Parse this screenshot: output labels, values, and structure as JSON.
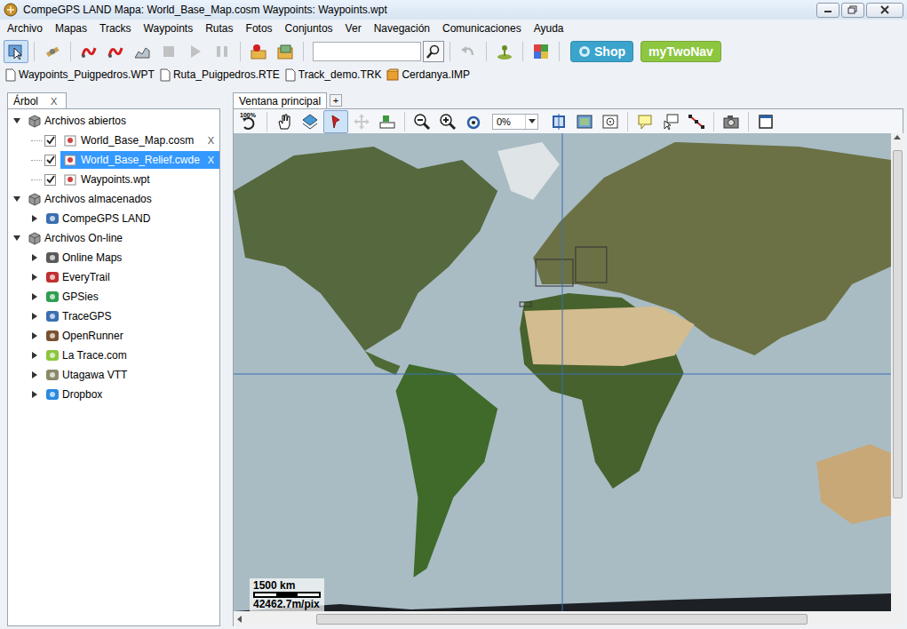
{
  "window": {
    "title": "CompeGPS LAND Mapa: World_Base_Map.cosm Waypoints:  Waypoints.wpt"
  },
  "menu": [
    "Archivo",
    "Mapas",
    "Tracks",
    "Waypoints",
    "Rutas",
    "Fotos",
    "Conjuntos",
    "Ver",
    "Navegación",
    "Comunicaciones",
    "Ayuda"
  ],
  "main_toolbar": {
    "buttons": [
      {
        "selected": true,
        "disabled": false
      },
      {
        "selected": false,
        "disabled": false
      },
      {
        "selected": false,
        "disabled": false
      },
      {
        "selected": false,
        "disabled": false
      },
      {
        "selected": false,
        "disabled": false
      },
      {
        "selected": false,
        "disabled": true
      },
      {
        "selected": false,
        "disabled": true
      },
      {
        "selected": false,
        "disabled": true
      },
      {
        "selected": false,
        "disabled": false
      },
      {
        "selected": false,
        "disabled": false
      },
      {
        "selected": false,
        "disabled": true
      },
      {
        "selected": false,
        "disabled": false
      },
      {
        "selected": false,
        "disabled": false
      }
    ],
    "search": {
      "value": ""
    },
    "shop": "Shop",
    "brand": "myTwoNav"
  },
  "open_files": [
    {
      "name": "Waypoints_Puigpedros.WPT",
      "kind": "document"
    },
    {
      "name": "Ruta_Puigpedros.RTE",
      "kind": "document"
    },
    {
      "name": "Track_demo.TRK",
      "kind": "document"
    },
    {
      "name": "Cerdanya.IMP",
      "kind": "package"
    }
  ],
  "tree_panel": {
    "tab": "Árbol",
    "close": "X"
  },
  "tree": [
    {
      "label": "Archivos abiertos",
      "expanded": true,
      "children": [
        {
          "kind": "layer",
          "label": "World_Base_Map.cosm",
          "checked": true,
          "selected": false,
          "close": "X"
        },
        {
          "kind": "layer",
          "label": "World_Base_Relief.cwde",
          "checked": true,
          "selected": true,
          "close": "X"
        },
        {
          "kind": "layer",
          "label": "Waypoints.wpt",
          "checked": true,
          "selected": false
        }
      ]
    },
    {
      "label": "Archivos almacenados",
      "expanded": true,
      "children": [
        {
          "kind": "source",
          "label": "CompeGPS LAND",
          "expanded": false
        }
      ]
    },
    {
      "label": "Archivos On-line",
      "expanded": true,
      "children": [
        {
          "kind": "source",
          "label": "Online Maps",
          "expanded": false
        },
        {
          "kind": "source",
          "label": "EveryTrail",
          "expanded": false
        },
        {
          "kind": "source",
          "label": "GPSies",
          "expanded": false
        },
        {
          "kind": "source",
          "label": "TraceGPS",
          "expanded": false
        },
        {
          "kind": "source",
          "label": "OpenRunner",
          "expanded": false
        },
        {
          "kind": "source",
          "label": "La Trace.com",
          "expanded": false
        },
        {
          "kind": "source",
          "label": "Utagawa VTT",
          "expanded": false
        },
        {
          "kind": "source",
          "label": "Dropbox",
          "expanded": false
        }
      ]
    }
  ],
  "map_panel": {
    "tab": "Ventana principal",
    "add": "+",
    "zoom_badge": "100%",
    "zoom": "0%",
    "buttons": [
      {
        "selected": false,
        "disabled": false
      },
      {
        "selected": false,
        "disabled": false
      },
      {
        "selected": false,
        "disabled": false
      },
      {
        "selected": true,
        "disabled": false
      },
      {
        "selected": false,
        "disabled": true
      },
      {
        "selected": false,
        "disabled": false
      },
      {
        "selected": false,
        "disabled": false
      },
      {
        "selected": false,
        "disabled": false
      },
      {
        "selected": false,
        "disabled": false
      },
      {
        "selected": false,
        "disabled": false
      },
      {
        "selected": false,
        "disabled": false
      },
      {
        "selected": false,
        "disabled": false
      },
      {
        "selected": false,
        "disabled": false
      },
      {
        "selected": false,
        "disabled": false
      },
      {
        "selected": false,
        "disabled": false
      },
      {
        "selected": false,
        "disabled": false
      },
      {
        "selected": false,
        "disabled": false
      }
    ]
  },
  "scale": {
    "distance": "1500 km",
    "resolution": "42462.7m/pix"
  }
}
